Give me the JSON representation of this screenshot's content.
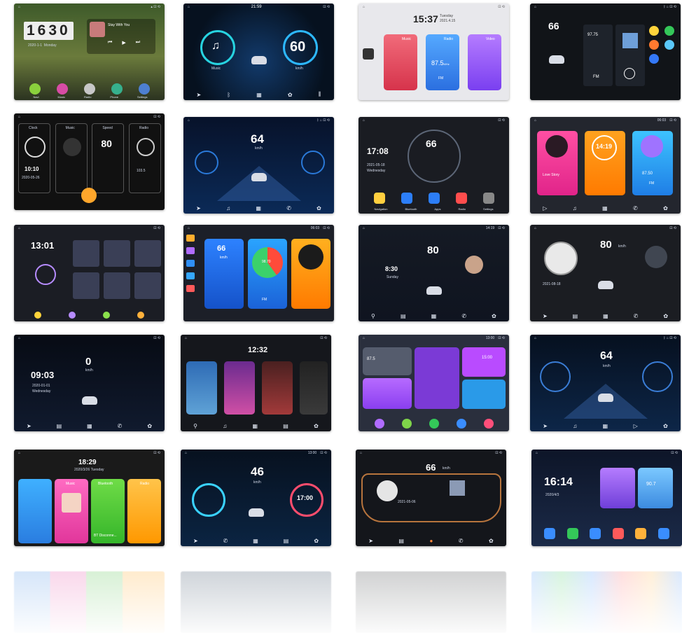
{
  "tiles": [
    {
      "clock": "1630",
      "date": "2020-1-1",
      "day": "Monday",
      "song": "Stay With You",
      "apps": [
        "Navi",
        "Music",
        "Radio",
        "Phone",
        "Settings"
      ]
    },
    {
      "time": "21:59",
      "speed": "60",
      "left_label": "Music",
      "right_label": "km/h"
    },
    {
      "time": "15:37",
      "date": "2021.4.15",
      "day": "Tuesday",
      "cards": [
        {
          "title": "Music"
        },
        {
          "title": "Radio",
          "value": "87.5",
          "unit": "MHz",
          "band": "FM"
        },
        {
          "title": "Video"
        }
      ]
    },
    {
      "speed": "66",
      "radio": "97.75",
      "band": "FM"
    },
    {
      "cols": [
        "Clock",
        "Music",
        "Speed",
        "Radio"
      ],
      "time": "10:10",
      "date": "2020-05-26",
      "speed": "80",
      "radio": "103.5"
    },
    {
      "speed": "64",
      "unit": "km/h"
    },
    {
      "time": "17:08",
      "speed": "66",
      "date": "2021-05-18",
      "day": "Wednesday",
      "apps": [
        "Navigation",
        "Bluetooth",
        "Apps",
        "Radio",
        "Settings"
      ]
    },
    {
      "time": "14:19",
      "song": "Love Story",
      "radio": "87.50",
      "band": "FM",
      "status_time": "06:03"
    },
    {
      "time": "13:01"
    },
    {
      "speed": "66",
      "unit": "km/h",
      "band": "FM",
      "radio": "98.70",
      "status_time": "06:03"
    },
    {
      "speed": "80",
      "time": "8:30",
      "day": "Sunday",
      "status_time": "14:19"
    },
    {
      "speed": "80",
      "unit": "km/h",
      "date": "2021-08-18"
    },
    {
      "time": "09:03",
      "speed": "0",
      "unit": "km/h",
      "date": "2020-01-01",
      "day": "Wednesday"
    },
    {
      "time": "12:32"
    },
    {
      "radio": "87.5",
      "time": "15:00",
      "status_time": "13:00"
    },
    {
      "speed": "64",
      "unit": "km/h"
    },
    {
      "time": "18:29",
      "date": "2020/3/26",
      "day": "Tuesday",
      "cards": [
        "Music",
        "Bluetooth",
        "Radio"
      ],
      "bt": "BT Disconne..."
    },
    {
      "speed": "46",
      "unit": "km/h",
      "time": "17:00",
      "status_time": "13:00"
    },
    {
      "speed": "66",
      "unit": "km/h",
      "date": "2021-05-06"
    },
    {
      "time": "16:14",
      "date": "2020/4/3",
      "radio": "90.7"
    }
  ]
}
